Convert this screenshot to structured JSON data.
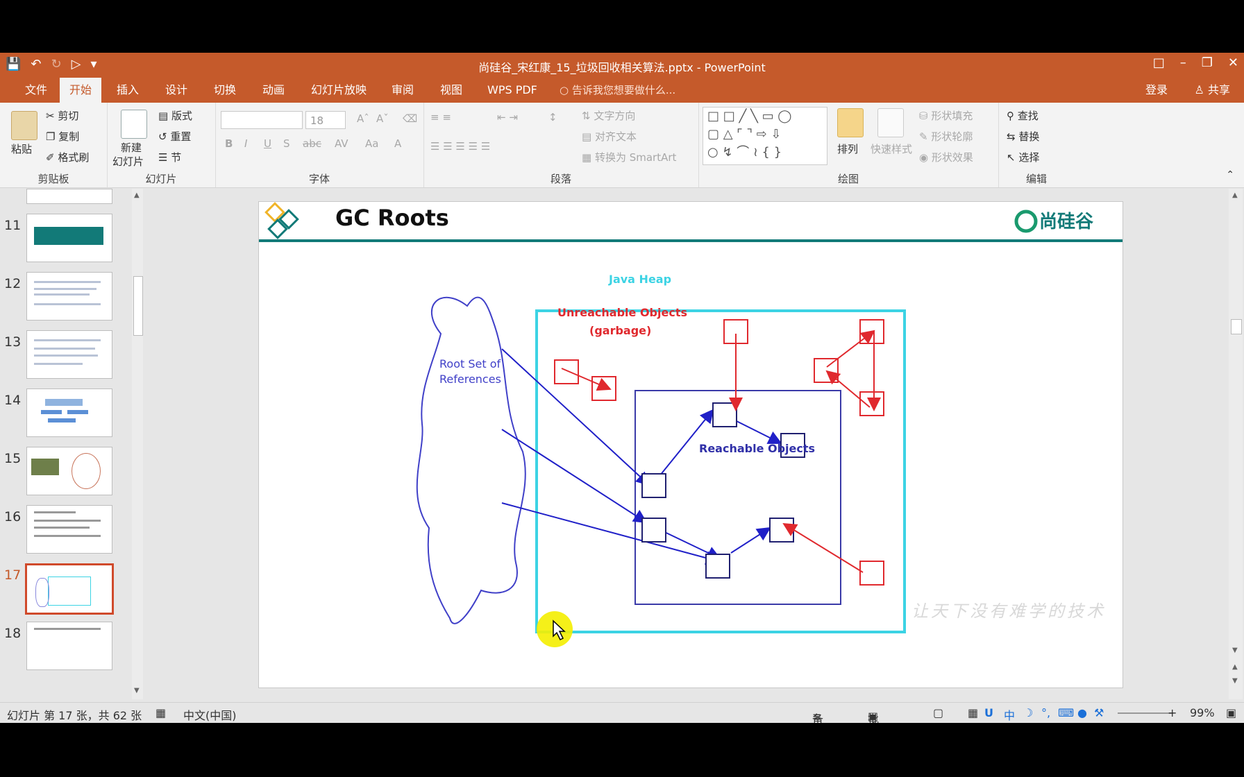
{
  "window": {
    "title": "尚硅谷_宋红康_15_垃圾回收相关算法.pptx - PowerPoint"
  },
  "tabs": [
    {
      "label": "文件"
    },
    {
      "label": "开始"
    },
    {
      "label": "插入"
    },
    {
      "label": "设计"
    },
    {
      "label": "切换"
    },
    {
      "label": "动画"
    },
    {
      "label": "幻灯片放映"
    },
    {
      "label": "审阅"
    },
    {
      "label": "视图"
    },
    {
      "label": "WPS PDF"
    }
  ],
  "tellme": "告诉我您想要做什么...",
  "account": {
    "login": "登录",
    "share": "共享"
  },
  "ribbon": {
    "clipboard": {
      "paste": "粘贴",
      "cut": "剪切",
      "copy": "复制",
      "format_painter": "格式刷",
      "label": "剪贴板"
    },
    "slides": {
      "new_slide_1": "新建",
      "new_slide_2": "幻灯片",
      "layout": "版式",
      "reset": "重置",
      "section": "节",
      "label": "幻灯片"
    },
    "font": {
      "size": "18",
      "bold": "B",
      "italic": "I",
      "underline": "U",
      "shadow": "S",
      "strike": "abc",
      "label": "字体"
    },
    "paragraph": {
      "text_direction": "文字方向",
      "align_text": "对齐文本",
      "smartart": "转换为 SmartArt",
      "label": "段落"
    },
    "drawing": {
      "arrange": "排列",
      "quick_styles": "快速样式",
      "shape_fill": "形状填充",
      "shape_outline": "形状轮廓",
      "shape_effects": "形状效果",
      "label": "绘图"
    },
    "editing": {
      "find": "查找",
      "replace": "替换",
      "select": "选择",
      "label": "编辑"
    }
  },
  "thumbnails": [
    {
      "num": "11"
    },
    {
      "num": "12"
    },
    {
      "num": "13"
    },
    {
      "num": "14"
    },
    {
      "num": "15"
    },
    {
      "num": "16"
    },
    {
      "num": "17"
    },
    {
      "num": "18"
    }
  ],
  "slide": {
    "title": "GC Roots",
    "brand": "尚硅谷",
    "heap_label": "Java Heap",
    "unreachable_1": "Unreachable Objects",
    "unreachable_2": "(garbage)",
    "root_set_1": "Root Set of",
    "root_set_2": "References",
    "reachable": "Reachable Objects",
    "watermark": "让天下没有难学的技术"
  },
  "status": {
    "slide_info": "幻灯片 第 17 张，共 62 张",
    "language": "中文(中国)",
    "notes": "备注",
    "comments": "批注",
    "ime": "中",
    "zoom": "99%"
  },
  "colors": {
    "accent": "#c55a2b",
    "heap_border": "#3cd3e4",
    "red": "#e0292e",
    "blue": "#2020c8",
    "teal": "#127a78"
  }
}
